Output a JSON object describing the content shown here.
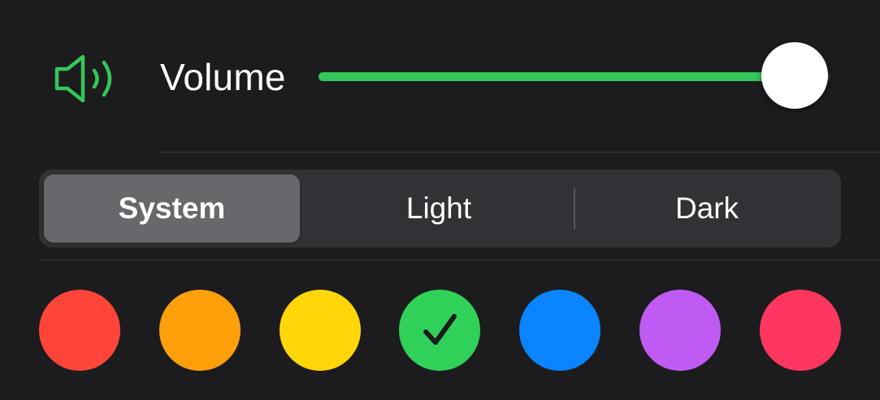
{
  "volume": {
    "label": "Volume",
    "level": 0.93,
    "icon": "speaker-wave-icon",
    "accent_color": "#34c759"
  },
  "appearance": {
    "segments": [
      {
        "label": "System",
        "selected": true
      },
      {
        "label": "Light",
        "selected": false
      },
      {
        "label": "Dark",
        "selected": false
      }
    ]
  },
  "colors": {
    "swatches": [
      {
        "name": "red",
        "hex": "#ff453a",
        "selected": false
      },
      {
        "name": "orange",
        "hex": "#ff9f0a",
        "selected": false
      },
      {
        "name": "yellow",
        "hex": "#ffd60a",
        "selected": false
      },
      {
        "name": "green",
        "hex": "#30d158",
        "selected": true
      },
      {
        "name": "blue",
        "hex": "#0a84ff",
        "selected": false
      },
      {
        "name": "purple",
        "hex": "#bf5af2",
        "selected": false
      },
      {
        "name": "pink",
        "hex": "#ff375f",
        "selected": false
      }
    ],
    "check_icon": "checkmark-icon"
  }
}
